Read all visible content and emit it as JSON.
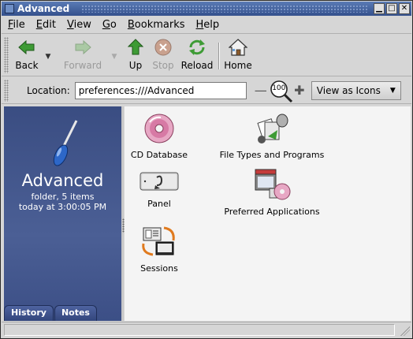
{
  "window": {
    "title": "Advanced",
    "controls": [
      "minimize",
      "maximize",
      "close"
    ]
  },
  "menubar": {
    "items": [
      {
        "label": "File",
        "mnemonic": "F"
      },
      {
        "label": "Edit",
        "mnemonic": "E"
      },
      {
        "label": "View",
        "mnemonic": "V"
      },
      {
        "label": "Go",
        "mnemonic": "G"
      },
      {
        "label": "Bookmarks",
        "mnemonic": "B"
      },
      {
        "label": "Help",
        "mnemonic": "H"
      }
    ]
  },
  "toolbar": {
    "back": "Back",
    "forward": "Forward",
    "up": "Up",
    "stop": "Stop",
    "reload": "Reload",
    "home": "Home"
  },
  "location": {
    "label": "Location:",
    "value": "preferences:///Advanced",
    "zoom": "100",
    "view_as": "View as Icons"
  },
  "sidebar": {
    "title": "Advanced",
    "info_line1": "folder, 5 items",
    "info_line2": "today at 3:00:05 PM",
    "tabs": [
      "History",
      "Notes"
    ]
  },
  "content": {
    "items": [
      {
        "label": "CD Database",
        "icon": "cd-icon"
      },
      {
        "label": "File Types and Programs",
        "icon": "file-types-icon"
      },
      {
        "label": "Panel",
        "icon": "panel-icon"
      },
      {
        "label": "Preferred Applications",
        "icon": "preferred-apps-icon"
      },
      {
        "label": "Sessions",
        "icon": "sessions-icon"
      }
    ]
  },
  "colors": {
    "titlebar": "#34508c",
    "sidebar": "#3a4d82",
    "content_bg": "#f4f4f4"
  }
}
